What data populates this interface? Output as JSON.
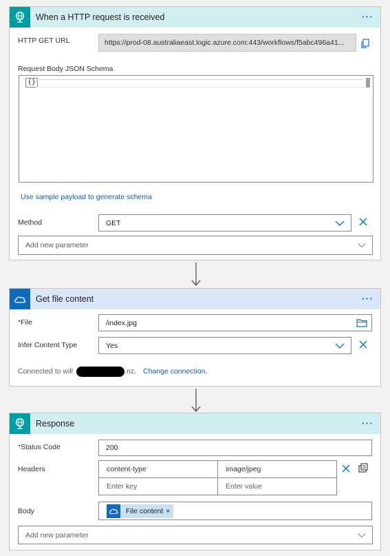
{
  "colors": {
    "accent": "#0078d4",
    "request_header_bg": "#d3eef2",
    "request_icon_bg": "#009da5",
    "onedrive_header_bg": "#d7e7f7",
    "onedrive_icon_bg": "#0f6cbd",
    "link": "#0f5ea8"
  },
  "trigger": {
    "title": "When a HTTP request is received",
    "icon": "globe-request-icon",
    "more": "···",
    "get_url_label": "HTTP GET URL",
    "get_url_value": "https://prod-08.australiaeast.logic.azure.com:443/workflows/f5abc496a41...",
    "copy_icon": "copy-icon",
    "schema_label": "Request Body JSON Schema",
    "schema_value": "{}",
    "sample_payload_link": "Use sample payload to generate schema",
    "method_label": "Method",
    "method_value": "GET",
    "add_param_placeholder": "Add new parameter"
  },
  "get_file": {
    "title": "Get file content",
    "icon": "onedrive-cloud-icon",
    "more": "···",
    "file_required": "*",
    "file_label": "File",
    "file_value": "/index.jpg",
    "folder_icon": "folder-icon",
    "infer_label": "Infer Content Type",
    "infer_value": "Yes",
    "connected_prefix": "Connected to will",
    "connected_suffix": ".nz.",
    "change_connection": "Change connection."
  },
  "response": {
    "title": "Response",
    "icon": "globe-request-icon",
    "more": "···",
    "status_required": "*",
    "status_label": "Status Code",
    "status_value": "200",
    "headers_label": "Headers",
    "headers": [
      {
        "key": "content-type",
        "value": "image/jpeg"
      }
    ],
    "key_placeholder": "Enter key",
    "value_placeholder": "Enter value",
    "body_label": "Body",
    "body_token": "File content",
    "body_token_close": "×",
    "add_param_placeholder": "Add new parameter"
  }
}
